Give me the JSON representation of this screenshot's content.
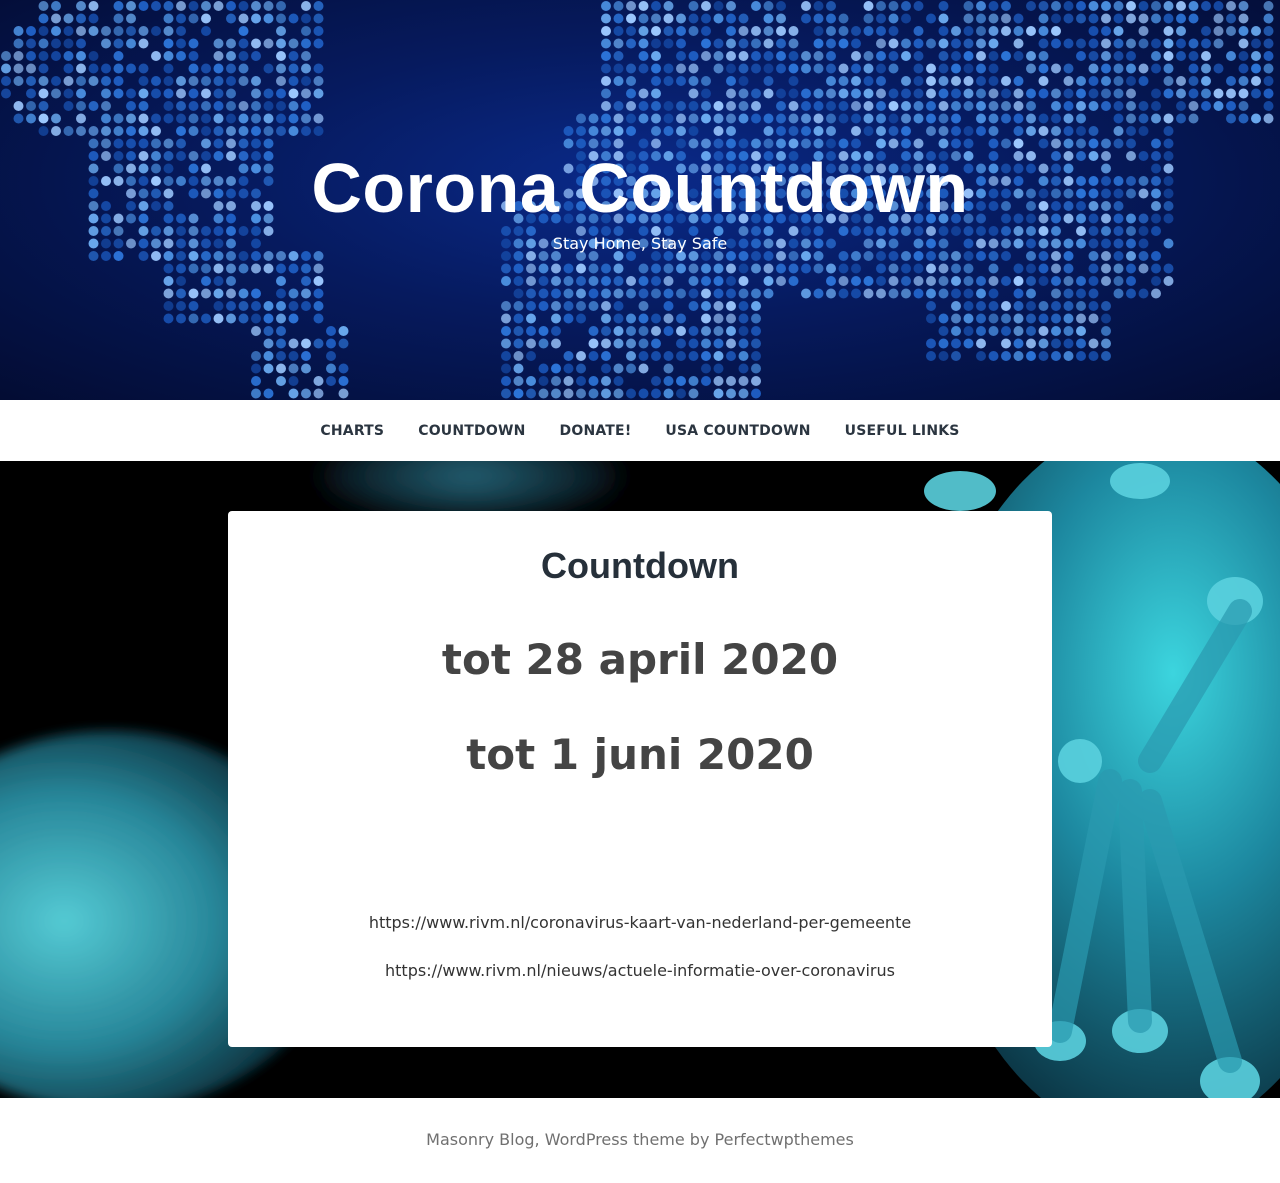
{
  "header": {
    "site_title": "Corona Countdown",
    "tagline": "Stay Home, Stay Safe",
    "background": "world-map-dots-image"
  },
  "nav": {
    "items": [
      {
        "label": "CHARTS"
      },
      {
        "label": "COUNTDOWN"
      },
      {
        "label": "DONATE!"
      },
      {
        "label": "USA COUNTDOWN"
      },
      {
        "label": "USEFUL LINKS"
      }
    ]
  },
  "content": {
    "background": "coronavirus-image",
    "page_title": "Countdown",
    "countdowns": [
      "tot 28 april 2020",
      "tot 1 juni 2020"
    ],
    "links": [
      "https://www.rivm.nl/coronavirus-kaart-van-nederland-per-gemeente",
      "https://www.rivm.nl/nieuws/actuele-informatie-over-coronavirus"
    ]
  },
  "footer": {
    "theme_name": "Masonry Blog",
    "separator": ", ",
    "credit_text": "WordPress theme by ",
    "author": "Perfectwpthemes"
  },
  "colors": {
    "header_bg": "#061a5e",
    "dot_color": "#4a8fe0",
    "title_text": "#ffffff",
    "nav_text": "#2b3540",
    "heading_text": "#26303a",
    "body_text": "#444444",
    "footer_text": "#707070",
    "virus_cyan": "#3fd8e6"
  }
}
